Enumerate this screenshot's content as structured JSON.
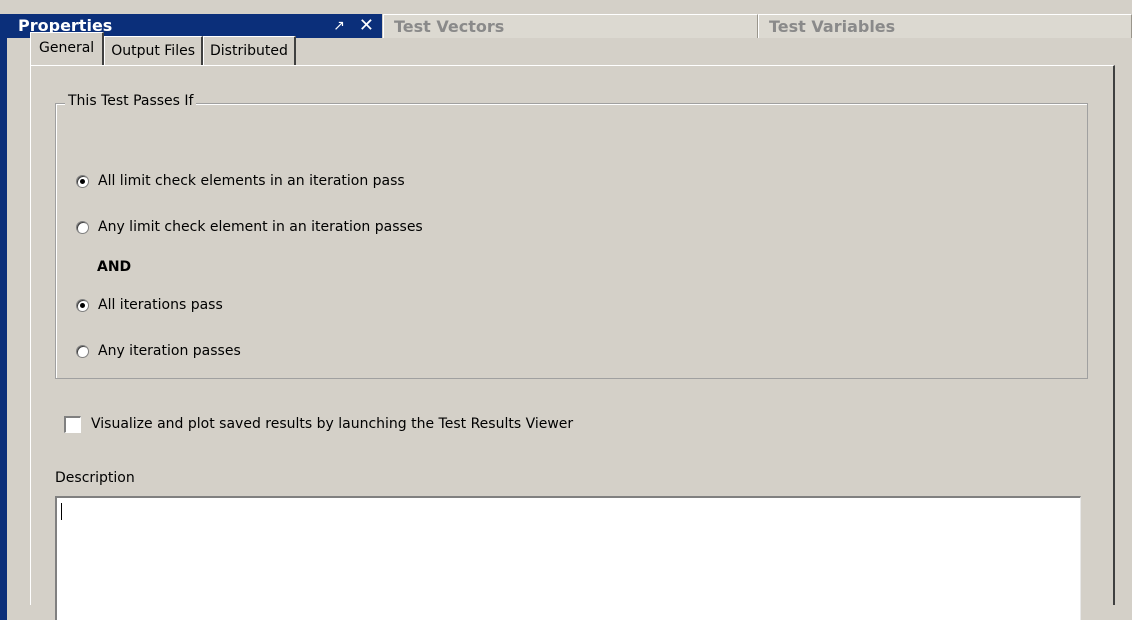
{
  "tabbar": {
    "active_tab": "Properties",
    "pin_glyph": "↗",
    "close_glyph": "✕",
    "tabs": [
      "Test Vectors",
      "Test Variables"
    ]
  },
  "property_tabs": [
    "General",
    "Output Files",
    "Distributed"
  ],
  "pass_group": {
    "legend": "This Test Passes If",
    "element_options": [
      {
        "label": "All limit check elements in an iteration pass",
        "checked": true
      },
      {
        "label": "Any limit check element in an iteration passes",
        "checked": false
      }
    ],
    "connector": "AND",
    "iteration_options": [
      {
        "label": "All iterations pass",
        "checked": true
      },
      {
        "label": "Any iteration passes",
        "checked": false
      }
    ]
  },
  "visualize": {
    "label": "Visualize and plot saved results by launching the Test Results Viewer",
    "checked": false
  },
  "description": {
    "label": "Description",
    "value": ""
  },
  "colors": {
    "active_tab_bg": "#0b2f7a",
    "panel_bg": "#d4d0c8"
  }
}
